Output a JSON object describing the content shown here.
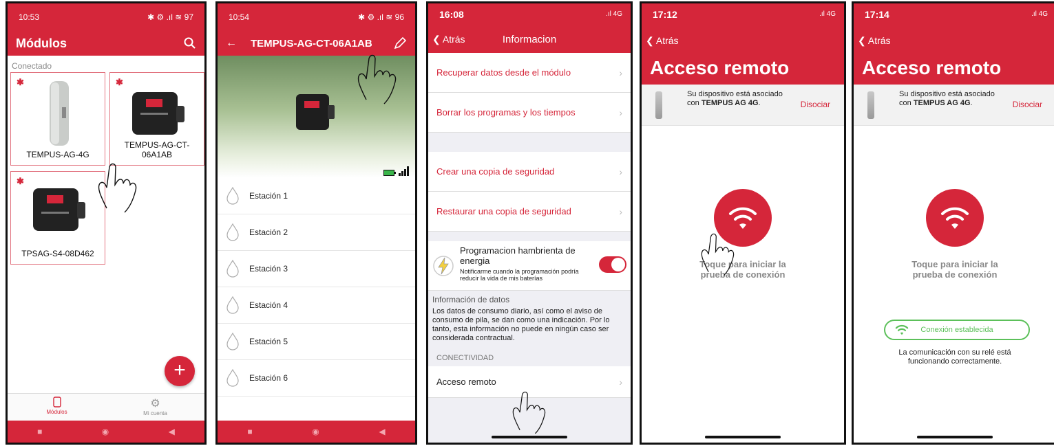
{
  "screen1": {
    "time": "10:53",
    "status_icons": "✱ ⚙ .ıl ≋ 97",
    "title": "Módulos",
    "section": "Conectado",
    "tiles": [
      {
        "name": "TEMPUS-AG-4G"
      },
      {
        "name": "TEMPUS-AG-CT-06A1AB"
      },
      {
        "name": "TPSAG-S4-08D462"
      }
    ],
    "fab": "+",
    "nav": {
      "modules": "Módulos",
      "account": "Mi cuenta"
    }
  },
  "screen2": {
    "time": "10:54",
    "status_icons": "✱ ⚙ .ıl ≋ 96",
    "title": "TEMPUS-AG-CT-06A1AB",
    "stations": [
      "Estación 1",
      "Estación 2",
      "Estación 3",
      "Estación 4",
      "Estación 5",
      "Estación 6"
    ]
  },
  "screen3": {
    "time": "16:08",
    "signal": ".ıl 4G",
    "back": "Atrás",
    "title": "Informacion",
    "rows1": [
      "Recuperar datos desde el módulo",
      "Borrar los programas y los tiempos"
    ],
    "rows2": [
      "Crear una copia de seguridad",
      "Restaurar una copia de seguridad"
    ],
    "toggle_title": "Programacion hambrienta de energia",
    "toggle_desc": "Notificarme cuando la programación podría reducir la vida de mis baterías",
    "info_title": "Información de datos",
    "info_text": "Los datos de consumo diario, así como el aviso de consumo de pila, se dan como una indicación. Por lo tanto, esta información no puede en ningún caso ser considerada contractual.",
    "section": "CONECTIVIDAD",
    "remote_row": "Acceso remoto"
  },
  "screen4": {
    "time": "17:12",
    "signal": ".ıl 4G",
    "back": "Atrás",
    "title": "Acceso remoto",
    "assoc_text": "Su dispositivo está asociado con",
    "device": "TEMPUS AG 4G",
    "dissociate": "Disociar",
    "tap_text": "Toque para iniciar la prueba de conexión"
  },
  "screen5": {
    "time": "17:14",
    "signal": ".ıl 4G",
    "back": "Atrás",
    "title": "Acceso remoto",
    "assoc_text": "Su dispositivo está asociado con",
    "device": "TEMPUS AG 4G",
    "dissociate": "Disociar",
    "tap_text": "Toque para iniciar la prueba de conexión",
    "connection": "Conexión establecida",
    "ok_message": "La comunicación con su relé está funcionando correctamente."
  },
  "colors": {
    "accent": "#d5263a",
    "success": "#5cc05a"
  }
}
